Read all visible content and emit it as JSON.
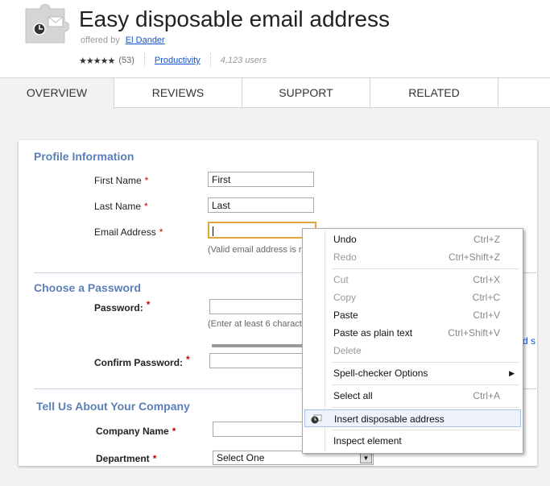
{
  "header": {
    "title": "Easy disposable email address",
    "offered_by": "offered by",
    "author": "El Dander",
    "stars": "★★★★★",
    "rating_count": "(53)",
    "category": "Productivity",
    "users": "4,123 users"
  },
  "tabs": [
    {
      "label": "OVERVIEW"
    },
    {
      "label": "REVIEWS"
    },
    {
      "label": "SUPPORT"
    },
    {
      "label": "RELATED"
    }
  ],
  "form": {
    "profile_title": "Profile Information",
    "first_name_label": "First Name",
    "first_name_value": "First",
    "last_name_label": "Last Name",
    "last_name_value": "Last",
    "email_label": "Email Address",
    "email_hint": "(Valid email address is re",
    "password_title": "Choose a Password",
    "password_label": "Password:",
    "password_hint": "(Enter at least 6 charact",
    "confirm_label": "Confirm Password:",
    "company_title": "Tell Us About Your Company",
    "company_label": "Company Name",
    "department_label": "Department",
    "department_value": "Select One",
    "required_mark": "*",
    "edge_fragment": "d s"
  },
  "context_menu": {
    "undo": {
      "label": "Undo",
      "shortcut": "Ctrl+Z"
    },
    "redo": {
      "label": "Redo",
      "shortcut": "Ctrl+Shift+Z"
    },
    "cut": {
      "label": "Cut",
      "shortcut": "Ctrl+X"
    },
    "copy": {
      "label": "Copy",
      "shortcut": "Ctrl+C"
    },
    "paste": {
      "label": "Paste",
      "shortcut": "Ctrl+V"
    },
    "paste_plain": {
      "label": "Paste as plain text",
      "shortcut": "Ctrl+Shift+V"
    },
    "delete": {
      "label": "Delete"
    },
    "spell": {
      "label": "Spell-checker Options"
    },
    "select_all": {
      "label": "Select all",
      "shortcut": "Ctrl+A"
    },
    "insert_disposable": {
      "label": "Insert disposable address"
    },
    "inspect": {
      "label": "Inspect element"
    }
  },
  "colors": {
    "link": "#1155cc",
    "section_title": "#5b7fb8",
    "required": "#cc0000",
    "focus_border": "#e0a63b",
    "menu_highlight": "#eef3fb"
  },
  "icons": [
    "puzzle-extension-icon",
    "clock-envelope-icon",
    "submenu-arrow-icon",
    "dropdown-arrow-icon"
  ]
}
